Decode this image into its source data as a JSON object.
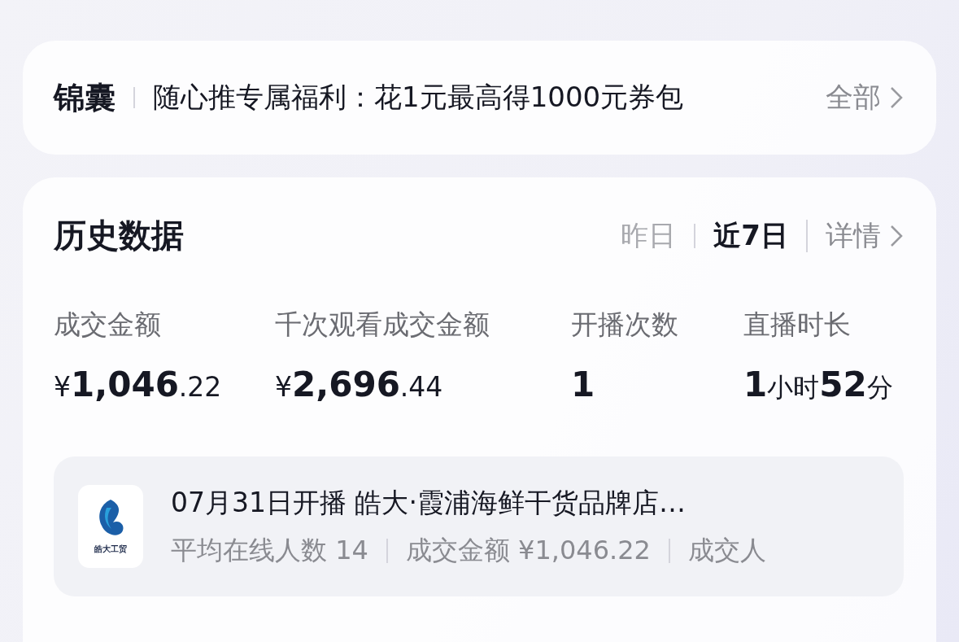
{
  "banner": {
    "title": "锦囊",
    "text": "随心推专属福利：花1元最高得1000元券包",
    "link": "全部"
  },
  "history": {
    "title": "历史数据",
    "tabs": [
      {
        "label": "昨日",
        "selected": false
      },
      {
        "label": "近7日",
        "selected": true
      }
    ],
    "link": "详情",
    "metrics": [
      {
        "label": "成交金额",
        "parts": [
          {
            "kind": "small",
            "text": "¥"
          },
          {
            "kind": "big",
            "text": "1,046"
          },
          {
            "kind": "small",
            "text": ".22"
          }
        ]
      },
      {
        "label": "千次观看成交金额",
        "parts": [
          {
            "kind": "small",
            "text": "¥"
          },
          {
            "kind": "big",
            "text": "2,696"
          },
          {
            "kind": "small",
            "text": ".44"
          }
        ]
      },
      {
        "label": "开播次数",
        "parts": [
          {
            "kind": "big",
            "text": "1"
          }
        ]
      },
      {
        "label": "直播时长",
        "parts": [
          {
            "kind": "big",
            "text": "1"
          },
          {
            "kind": "unit",
            "text": "小时"
          },
          {
            "kind": "big",
            "text": "52"
          },
          {
            "kind": "unit",
            "text": "分"
          }
        ]
      }
    ],
    "session": {
      "logo_text": "皓大工贸",
      "title": "07月31日开播  皓大·霞浦海鲜干货品牌店…",
      "stats": [
        "平均在线人数 14",
        "成交金额 ¥1,046.22",
        "成交人"
      ]
    }
  }
}
